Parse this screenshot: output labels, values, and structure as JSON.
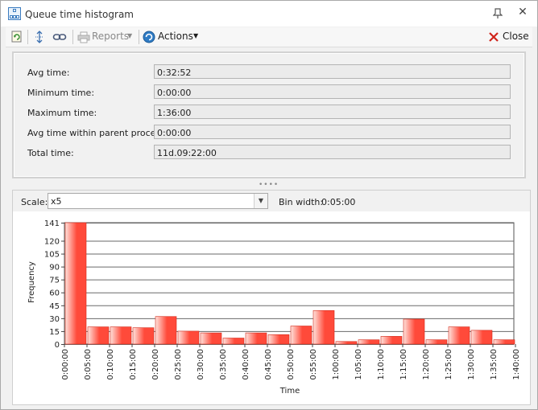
{
  "window": {
    "title": "Queue time histogram",
    "close_label": "Close"
  },
  "toolbar": {
    "reports_label": "Reports",
    "actions_label": "Actions"
  },
  "properties": [
    {
      "label": "Avg time:",
      "value": "0:32:52"
    },
    {
      "label": "Minimum time:",
      "value": "0:00:00"
    },
    {
      "label": "Maximum time:",
      "value": "1:36:00"
    },
    {
      "label": "Avg time within parent process:",
      "value": "0:00:00"
    },
    {
      "label": "Total time:",
      "value": "11d.09:22:00"
    }
  ],
  "scale": {
    "label": "Scale:",
    "value": "x5",
    "bin_width_label": "Bin width:",
    "bin_width_value": "0:05:00"
  },
  "colors": {
    "bar_top": "#ff4a3a",
    "bar_bottom": "#ffe2dc",
    "bar_stroke": "#d22a1a"
  },
  "chart_data": {
    "type": "bar",
    "xlabel": "Time",
    "ylabel": "Frequency",
    "ylim": [
      0,
      141
    ],
    "yticks": [
      0,
      15,
      30,
      45,
      60,
      75,
      90,
      105,
      120,
      141
    ],
    "grid": true,
    "categories": [
      "0:00:00",
      "0:05:00",
      "0:10:00",
      "0:15:00",
      "0:20:00",
      "0:25:00",
      "0:30:00",
      "0:35:00",
      "0:40:00",
      "0:45:00",
      "0:50:00",
      "0:55:00",
      "1:00:00",
      "1:05:00",
      "1:10:00",
      "1:15:00",
      "1:20:00",
      "1:25:00",
      "1:30:00",
      "1:35:00",
      "1:40:00"
    ],
    "values": [
      141,
      20,
      20,
      19,
      32,
      15,
      13,
      7,
      13,
      11,
      21,
      39,
      3,
      5,
      9,
      29,
      5,
      20,
      16,
      5
    ]
  }
}
